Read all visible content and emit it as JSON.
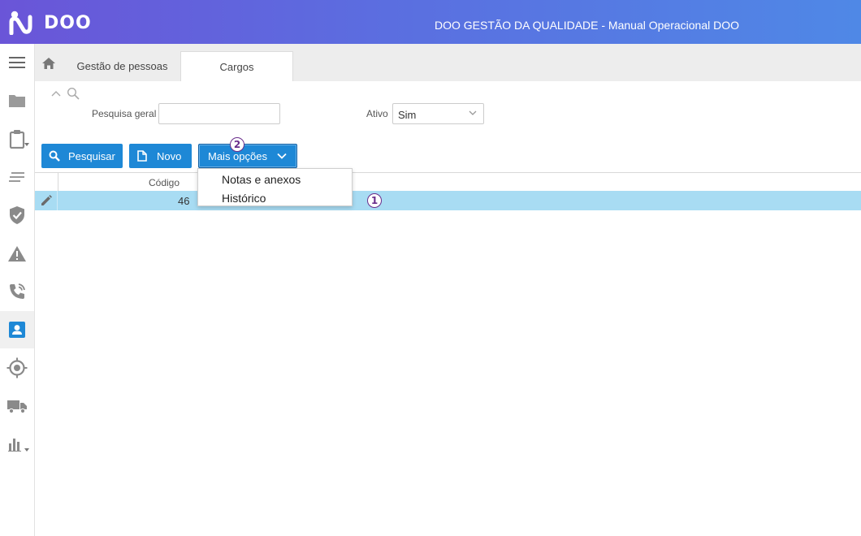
{
  "header": {
    "logo_text": "DOO",
    "app_title": "DOO GESTÃO DA QUALIDADE - Manual Operacional DOO"
  },
  "sidebar": {
    "items": [
      {
        "icon": "menu-icon"
      },
      {
        "icon": "folder-icon"
      },
      {
        "icon": "clipboard-icon"
      },
      {
        "icon": "list-icon"
      },
      {
        "icon": "shield-check-icon"
      },
      {
        "icon": "warning-icon"
      },
      {
        "icon": "phone-icon"
      },
      {
        "icon": "contact-card-icon",
        "active": true
      },
      {
        "icon": "target-icon"
      },
      {
        "icon": "truck-icon"
      },
      {
        "icon": "bar-chart-icon"
      }
    ]
  },
  "tabs": [
    {
      "label": "Gestão de pessoas",
      "active": false
    },
    {
      "label": "Cargos",
      "active": true
    }
  ],
  "filters": {
    "search_label": "Pesquisa geral",
    "search_value": "",
    "active_label": "Ativo",
    "active_value": "Sim"
  },
  "toolbar": {
    "search_button": "Pesquisar",
    "new_button": "Novo",
    "more_button": "Mais opções"
  },
  "dropdown": {
    "items": [
      "Notas e anexos",
      "Histórico"
    ]
  },
  "grid": {
    "columns": [
      "Código"
    ],
    "rows": [
      {
        "code": "46"
      }
    ]
  },
  "annotations": [
    "1",
    "2"
  ],
  "colors": {
    "primary": "#1e88d6",
    "selected_row": "#a8dcf3",
    "header_gradient_start": "#6a55d8",
    "header_gradient_end": "#4f88e6",
    "badge": "#6a2e8c"
  }
}
